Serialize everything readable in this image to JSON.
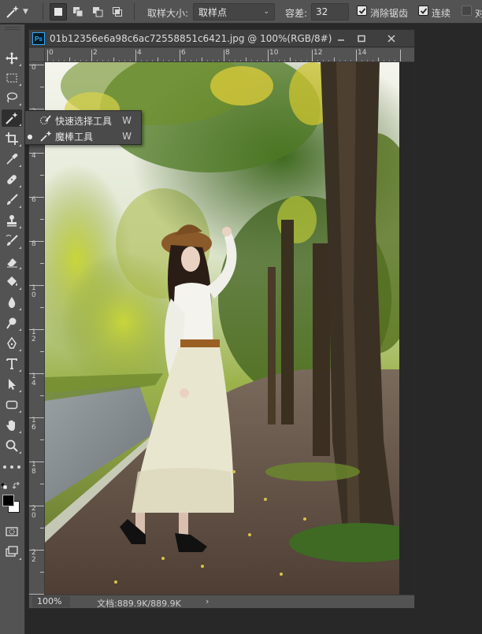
{
  "options_bar": {
    "sample_size_label": "取样大小:",
    "sample_size_value": "取样点",
    "tolerance_label": "容差:",
    "tolerance_value": "32",
    "antialias_label": "消除锯齿",
    "antialias_checked": true,
    "contiguous_label": "连续",
    "contiguous_checked": true,
    "sample_all_label": "对",
    "sample_all_checked": false
  },
  "toolbox": {
    "tools": [
      "move-tool",
      "marquee-tool",
      "lasso-tool",
      "magic-wand-tool",
      "crop-tool",
      "eyedropper-tool",
      "healing-brush-tool",
      "brush-tool",
      "clone-stamp-tool",
      "history-brush-tool",
      "eraser-tool",
      "paint-bucket-tool",
      "blur-tool",
      "dodge-tool",
      "pen-tool",
      "type-tool",
      "path-selection-tool",
      "rectangle-tool",
      "hand-tool",
      "zoom-tool"
    ],
    "active_tool": "magic-wand-tool",
    "foreground_color": "#000000",
    "background_color": "#ffffff"
  },
  "flyout": {
    "items": [
      {
        "label": "快速选择工具",
        "shortcut": "W",
        "selected": false
      },
      {
        "label": "魔棒工具",
        "shortcut": "W",
        "selected": true
      }
    ]
  },
  "document": {
    "title": "01b12356e6a98c6ac72558851c6421.jpg @ 100%(RGB/8#)",
    "app_badge": "Ps",
    "ruler_h_labels": [
      "0",
      "2",
      "4",
      "6",
      "8",
      "10",
      "12",
      "14"
    ],
    "ruler_v_labels": [
      "0",
      "2",
      "4",
      "6",
      "8",
      "10",
      "12",
      "14",
      "16",
      "18",
      "20",
      "22"
    ],
    "zoom": "100%",
    "status": "文档:889.9K/889.9K",
    "status_arrow": "›"
  },
  "colors": {
    "panel": "#535353",
    "background": "#282828",
    "accent_ps": "#31a8ff"
  }
}
